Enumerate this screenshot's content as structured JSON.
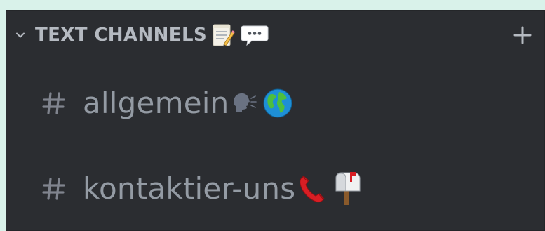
{
  "category": {
    "title": "TEXT CHANNELS",
    "collapse_icon": "chevron-down-icon",
    "emojis": [
      "memo-emoji",
      "speech-bubble-emoji"
    ],
    "add_icon": "plus-icon"
  },
  "channels": [
    {
      "name": "allgemein",
      "icon": "hash-icon",
      "emojis": [
        "speaking-head-emoji",
        "globe-emoji"
      ]
    },
    {
      "name": "kontaktier-uns",
      "icon": "hash-icon",
      "emojis": [
        "telephone-receiver-emoji",
        "mailbox-emoji"
      ]
    }
  ],
  "colors": {
    "background": "#2b2d31",
    "category_text": "#b5bac1",
    "channel_text": "#949ba4",
    "page_bg": "#d9f2ea"
  }
}
